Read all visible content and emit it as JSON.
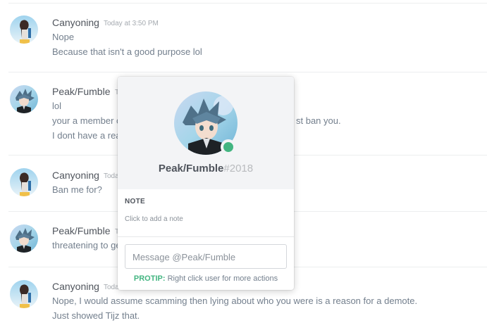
{
  "messages": [
    {
      "author": "Canyoning",
      "timestamp": "Today at 3:50 PM",
      "lines": [
        "Nope",
        "Because that isn't a good purpose lol"
      ]
    },
    {
      "author": "Peak/Fumble",
      "timestamp": "T",
      "lines": [
        "lol",
        "your a member c",
        "I dont have a rea"
      ],
      "line_tails": [
        "",
        "st ban you.",
        ""
      ]
    },
    {
      "author": "Canyoning",
      "timestamp": "Toda",
      "lines": [
        "Ban me for?"
      ]
    },
    {
      "author": "Peak/Fumble",
      "timestamp": "T",
      "lines": [
        "threatening to ge"
      ]
    },
    {
      "author": "Canyoning",
      "timestamp": "Toda",
      "lines": [
        "Nope, I would assume scamming then lying about who you were is a reason for a demote.",
        "Just showed Tijz that."
      ]
    }
  ],
  "popout": {
    "username": "Peak/Fumble",
    "discriminator": "#2018",
    "status": "online",
    "note_label": "NOTE",
    "note_placeholder": "Click to add a note",
    "message_placeholder": "Message @Peak/Fumble",
    "protip_label": "PROTIP:",
    "protip_text": " Right click user for more actions"
  },
  "colors": {
    "online": "#43b581",
    "accent_protip": "#43b581"
  }
}
